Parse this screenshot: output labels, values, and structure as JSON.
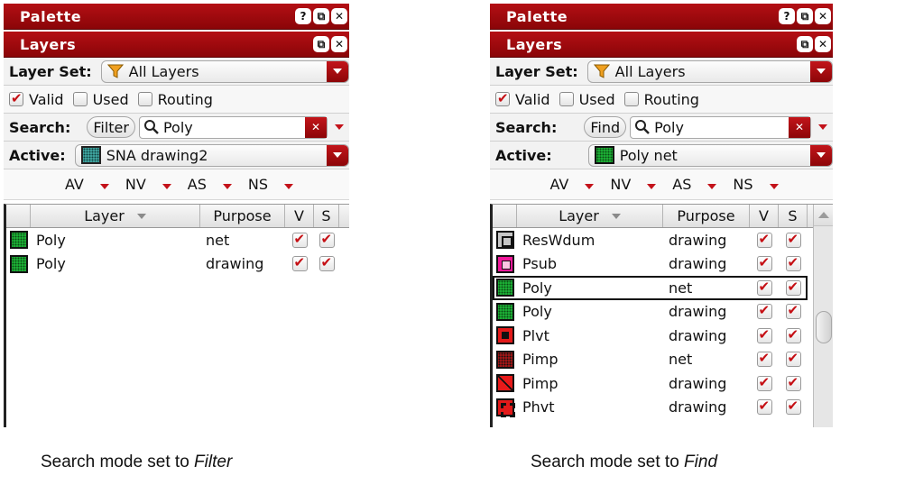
{
  "colors": {
    "titlebar": "#a00a0f",
    "accent_red": "#c50f14",
    "green_layer": "#1fc43c"
  },
  "left": {
    "palette_title": "Palette",
    "palette_buttons": [
      "?",
      "⧉",
      "✕"
    ],
    "layers_title": "Layers",
    "layers_buttons": [
      "⧉",
      "✕"
    ],
    "layer_set_label": "Layer Set:",
    "layer_set_value": "All Layers",
    "checkboxes": [
      {
        "label": "Valid",
        "checked": true
      },
      {
        "label": "Used",
        "checked": false
      },
      {
        "label": "Routing",
        "checked": false
      }
    ],
    "search_label": "Search:",
    "search_mode": "Filter",
    "search_value": "Poly",
    "active_label": "Active:",
    "active_value": "SNA drawing2",
    "visibility_columns": [
      "AV",
      "NV",
      "AS",
      "NS"
    ],
    "table_headers": {
      "layer": "Layer",
      "purpose": "Purpose",
      "v": "V",
      "s": "S"
    },
    "rows": [
      {
        "swatch": "green",
        "layer": "Poly",
        "purpose": "net",
        "v": true,
        "s": true
      },
      {
        "swatch": "green",
        "layer": "Poly",
        "purpose": "drawing",
        "v": true,
        "s": true
      }
    ],
    "caption_prefix": "Search mode set to ",
    "caption_mode": "Filter"
  },
  "right": {
    "palette_title": "Palette",
    "palette_buttons": [
      "?",
      "⧉",
      "✕"
    ],
    "layers_title": "Layers",
    "layers_buttons": [
      "⧉",
      "✕"
    ],
    "layer_set_label": "Layer Set:",
    "layer_set_value": "All Layers",
    "checkboxes": [
      {
        "label": "Valid",
        "checked": true
      },
      {
        "label": "Used",
        "checked": false
      },
      {
        "label": "Routing",
        "checked": false
      }
    ],
    "search_label": "Search:",
    "search_mode": "Find",
    "search_value": "Poly",
    "active_label": "Active:",
    "active_value": "Poly net",
    "visibility_columns": [
      "AV",
      "NV",
      "AS",
      "NS"
    ],
    "table_headers": {
      "layer": "Layer",
      "purpose": "Purpose",
      "v": "V",
      "s": "S"
    },
    "rows": [
      {
        "swatch": "gray",
        "layer": "ResWdum",
        "purpose": "drawing",
        "v": true,
        "s": true,
        "selected": false
      },
      {
        "swatch": "pink",
        "layer": "Psub",
        "purpose": "drawing",
        "v": true,
        "s": true,
        "selected": false
      },
      {
        "swatch": "green",
        "layer": "Poly",
        "purpose": "net",
        "v": true,
        "s": true,
        "selected": true
      },
      {
        "swatch": "green",
        "layer": "Poly",
        "purpose": "drawing",
        "v": true,
        "s": true,
        "selected": false
      },
      {
        "swatch": "red",
        "layer": "Plvt",
        "purpose": "drawing",
        "v": true,
        "s": true,
        "selected": false
      },
      {
        "swatch": "dotred",
        "layer": "Pimp",
        "purpose": "net",
        "v": true,
        "s": true,
        "selected": false
      },
      {
        "swatch": "diag",
        "layer": "Pimp",
        "purpose": "drawing",
        "v": true,
        "s": true,
        "selected": false
      },
      {
        "swatch": "phvt",
        "layer": "Phvt",
        "purpose": "drawing",
        "v": true,
        "s": true,
        "selected": false
      }
    ],
    "caption_prefix": "Search mode set to ",
    "caption_mode": "Find"
  }
}
